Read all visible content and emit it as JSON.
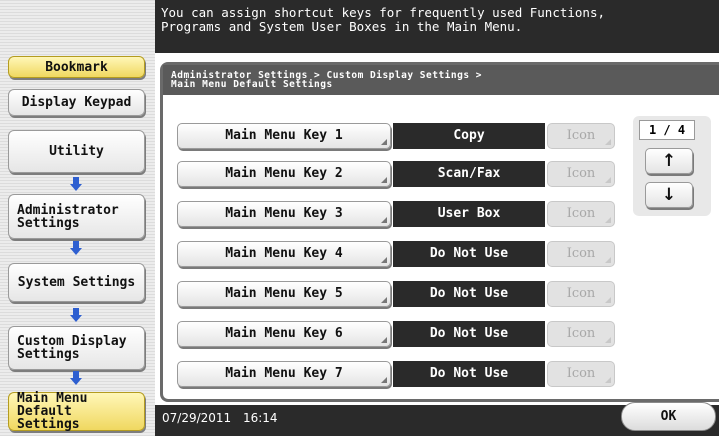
{
  "message": "You can assign shortcut keys for frequently used Functions,\nPrograms and System User Boxes in the Main Menu.",
  "sidebar": {
    "bookmark": "Bookmark",
    "display_keypad": "Display Keypad",
    "steps": [
      "Utility",
      "Administrator Settings",
      "System Settings",
      "Custom Display Settings",
      "Main Menu Default Settings"
    ]
  },
  "breadcrumb": "Administrator Settings > Custom Display Settings >\nMain Menu Default Settings",
  "keys": [
    {
      "label": "Main Menu Key 1",
      "value": "Copy",
      "icon": "Icon"
    },
    {
      "label": "Main Menu Key 2",
      "value": "Scan/Fax",
      "icon": "Icon"
    },
    {
      "label": "Main Menu Key 3",
      "value": "User Box",
      "icon": "Icon"
    },
    {
      "label": "Main Menu Key 4",
      "value": "Do Not Use",
      "icon": "Icon"
    },
    {
      "label": "Main Menu Key 5",
      "value": "Do Not Use",
      "icon": "Icon"
    },
    {
      "label": "Main Menu Key 6",
      "value": "Do Not Use",
      "icon": "Icon"
    },
    {
      "label": "Main Menu Key 7",
      "value": "Do Not Use",
      "icon": "Icon"
    }
  ],
  "pager": {
    "indicator": "1 / 4",
    "up": "↑",
    "down": "↓"
  },
  "footer": {
    "datetime": "07/29/2011 16:14",
    "ok": "OK"
  },
  "colors": {
    "accent_yellow": "#f0d860",
    "arrow_blue": "#2e5fd0",
    "dark_bar": "#2a2a2a"
  }
}
